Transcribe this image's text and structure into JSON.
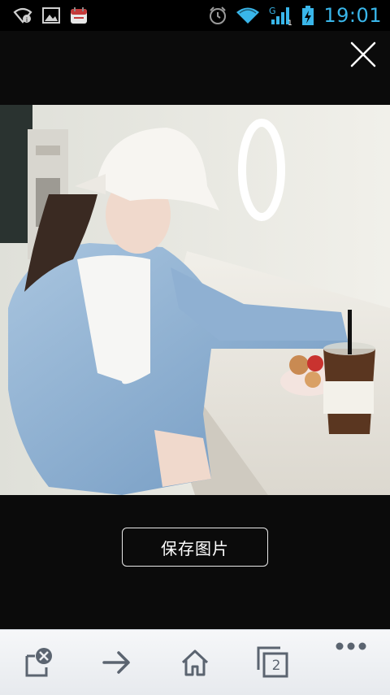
{
  "status_bar": {
    "time": "19:01",
    "icons": [
      "wifi-sync-icon",
      "image-notification-icon",
      "calendar-app-icon",
      "alarm-icon",
      "wifi-icon",
      "signal-icon",
      "battery-charging-icon"
    ],
    "network_label": "G",
    "sim_label": "1"
  },
  "viewer": {
    "close_icon": "close-icon",
    "save_label": "保存图片"
  },
  "toolbar": {
    "items": [
      "close-tab-icon",
      "forward-arrow-icon",
      "home-icon",
      "tabs-icon",
      "more-icon"
    ],
    "tab_count": "2"
  },
  "colors": {
    "background": "#0b0b0b",
    "clock": "#39b6ea",
    "toolbar": "#eceef1",
    "toolbar_icon": "#5b6470"
  }
}
